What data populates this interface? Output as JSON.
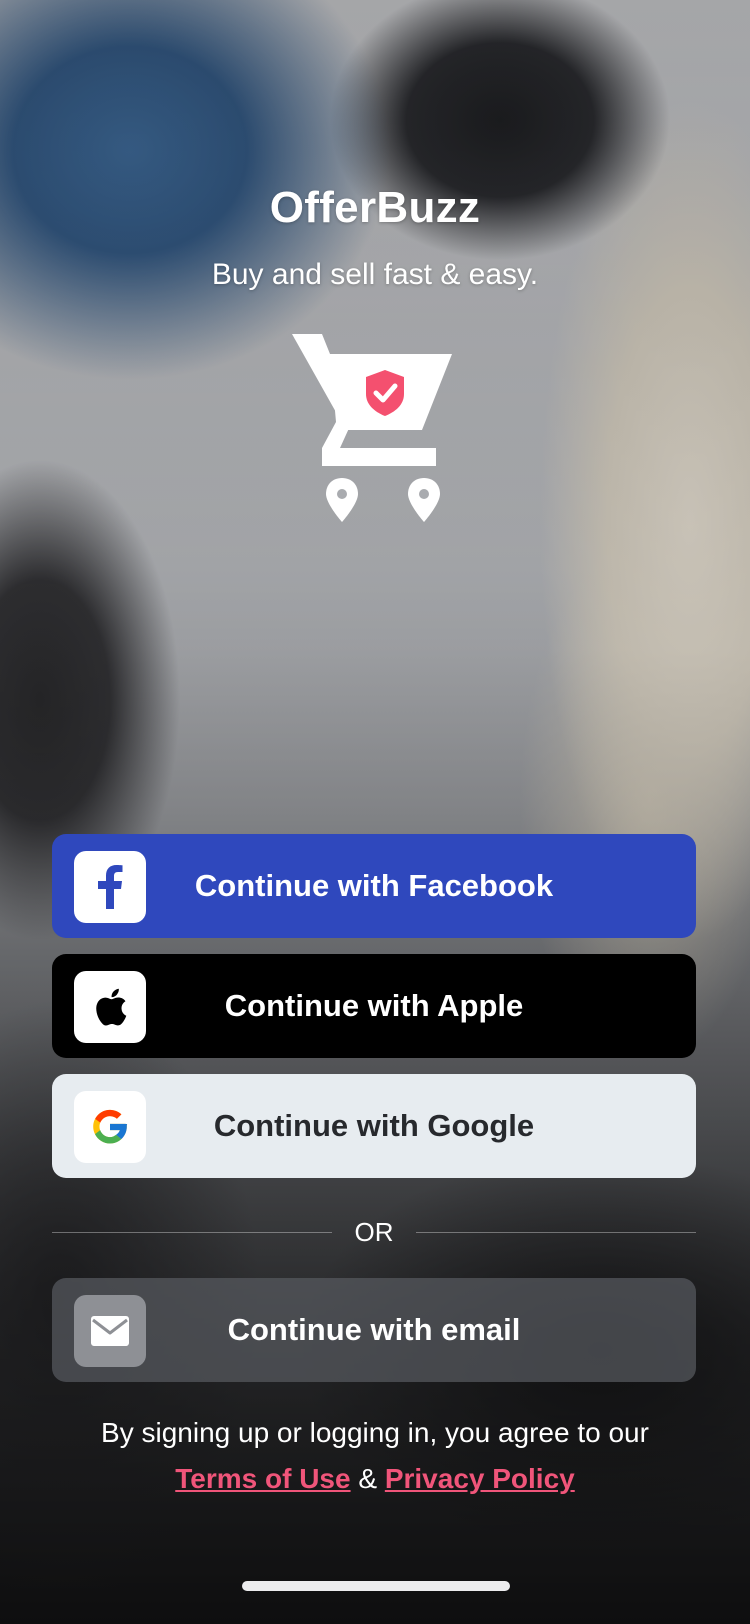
{
  "app": {
    "name": "OfferBuzz",
    "tagline": "Buy and sell fast & easy."
  },
  "auth_buttons": {
    "facebook": {
      "label": "Continue with Facebook",
      "icon": "facebook-icon",
      "color": "#2f48bd"
    },
    "apple": {
      "label": "Continue with Apple",
      "icon": "apple-icon",
      "color": "#000000"
    },
    "google": {
      "label": "Continue with Google",
      "icon": "google-icon",
      "color": "#e7ecf0"
    },
    "email": {
      "label": "Continue with email",
      "icon": "mail-icon"
    }
  },
  "divider": {
    "label": "OR"
  },
  "legal": {
    "text": "By signing up or logging in, you agree to our",
    "terms": "Terms of Use",
    "conjunction": "&",
    "privacy": "Privacy Policy",
    "link_color": "#f0557a"
  },
  "logo": {
    "icon": "shopping-cart-shield-icon",
    "accent": "#f4506f"
  }
}
